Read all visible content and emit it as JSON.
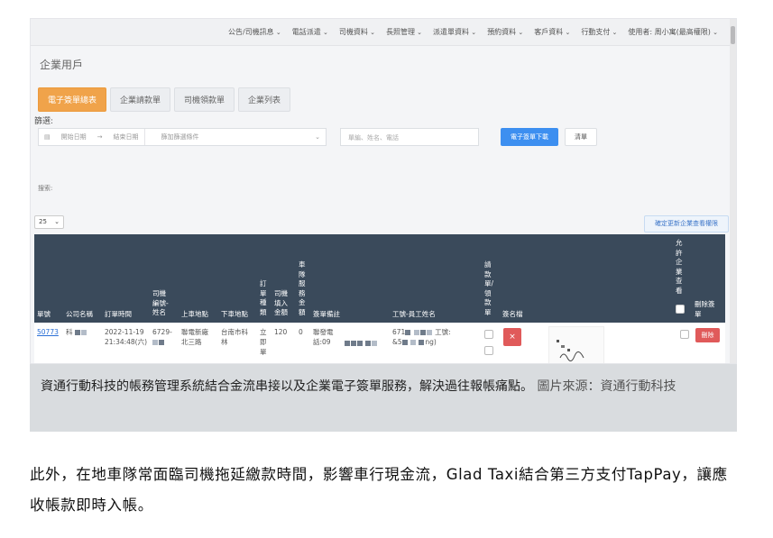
{
  "topnav": {
    "items": [
      "公告/司機訊息",
      "電話派遣",
      "司機資料",
      "長照管理",
      "派遣單資料",
      "預約資料",
      "客戶資料",
      "行動支付",
      "使用者: 周小寓(最高權限)"
    ]
  },
  "page": {
    "title": "企業用戶",
    "tabs": [
      "電子簽單總表",
      "企業請款單",
      "司機領款單",
      "企業列表"
    ],
    "filter_label": "篩選:",
    "date_start_placeholder": "開始日期",
    "date_end_placeholder": "結束日期",
    "condition_placeholder": "篩加篩選條件",
    "search_placeholder": "單編、姓名、電話",
    "download_button": "電子簽單下載",
    "clear_button": "清單",
    "search_label": "搜索:",
    "per_page": "25",
    "update_button": "確定更新企業查看權限"
  },
  "table": {
    "headers": {
      "order_no": "單號",
      "company": "公司名稱",
      "order_time": "訂單時間",
      "driver": "司機\n編號-\n姓名",
      "pickup": "上車地點",
      "dropoff": "下車地點",
      "order_type": "訂\n單\n種\n類",
      "driver_fill": "司機\n填入\n金額",
      "fleet_fee": "車\n隊\n服\n務\n金\n額",
      "remark": "簽單備註",
      "employee": "工號-員工姓名",
      "billing": "請\n款\n單/\n領\n款\n單",
      "signature": "簽名檔",
      "allow_view": "允\n許\n企\n業\n查\n看",
      "delete": "刪除簽\n單"
    },
    "row": {
      "order_no": "50773",
      "company": "科",
      "order_time": "2022-11-19\n21:34:48(六)",
      "driver": "6729-",
      "pickup": "聯電新廠\n北三路",
      "dropoff": "台南市科\n林",
      "order_type": "立\n即\n單",
      "driver_fill": "120",
      "fleet_fee": "0",
      "remark": "聯發電\n話:09",
      "employee_1": "671",
      "employee_2": "&5",
      "employee_tail": "工號:",
      "employee_tail2": "ng)",
      "x_button": "×",
      "delete_button": "刪除"
    }
  },
  "caption": {
    "text": "資通行動科技的帳務管理系統結合金流串接以及企業電子簽單服務，解決過往報帳痛點。",
    "source": "圖片來源：資通行動科技"
  },
  "article": {
    "paragraph": "此外，在地車隊常面臨司機拖延繳款時間，影響車行現金流，Glad Taxi結合第三方支付TapPay，讓應收帳款即時入帳。"
  }
}
